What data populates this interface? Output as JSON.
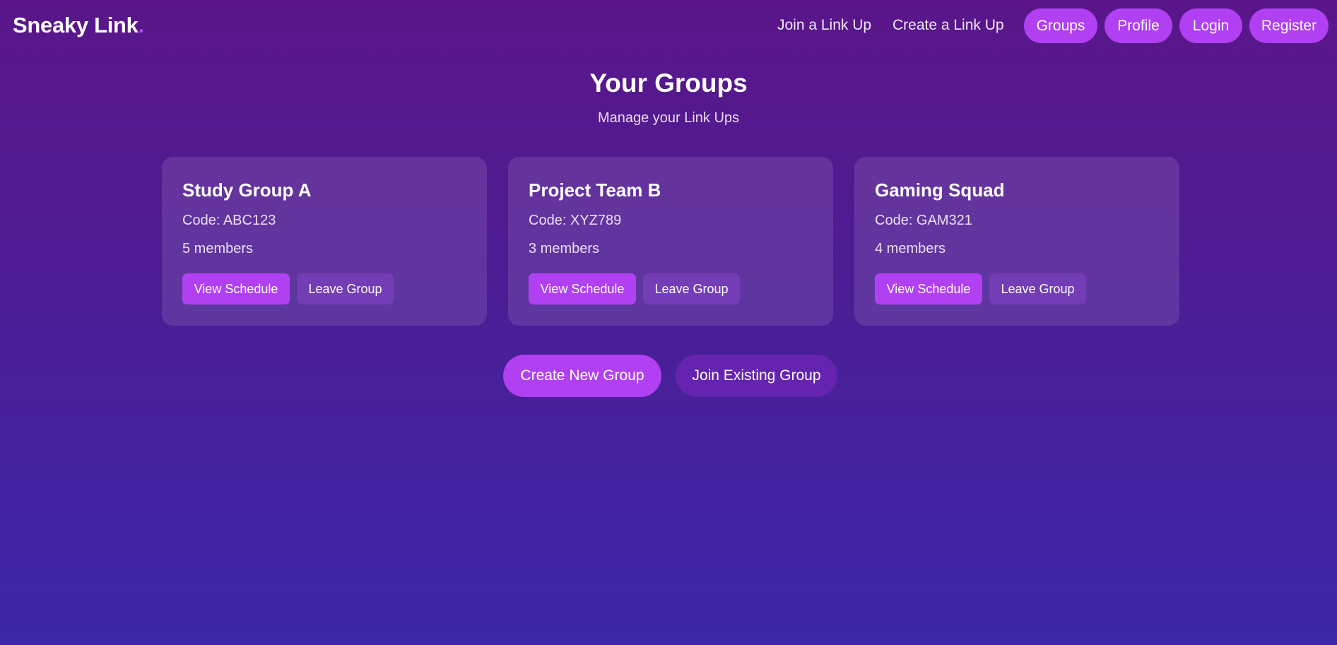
{
  "nav": {
    "logo": "Sneaky Link",
    "logo_dot": ".",
    "links": [
      "Join a Link Up",
      "Create a Link Up"
    ],
    "pills": [
      "Groups",
      "Profile",
      "Login",
      "Register"
    ]
  },
  "main": {
    "title": "Your Groups",
    "subtitle": "Manage your Link Ups"
  },
  "groups": [
    {
      "name": "Study Group A",
      "code": "Code: ABC123",
      "members": "5 members",
      "view_label": "View Schedule",
      "leave_label": "Leave Group"
    },
    {
      "name": "Project Team B",
      "code": "Code: XYZ789",
      "members": "3 members",
      "view_label": "View Schedule",
      "leave_label": "Leave Group"
    },
    {
      "name": "Gaming Squad",
      "code": "Code: GAM321",
      "members": "4 members",
      "view_label": "View Schedule",
      "leave_label": "Leave Group"
    }
  ],
  "actions": {
    "create_label": "Create New Group",
    "join_label": "Join Existing Group"
  },
  "colors": {
    "accent": "#b040f2",
    "background_top": "#5a1689",
    "background_bottom": "#3b27a8"
  }
}
